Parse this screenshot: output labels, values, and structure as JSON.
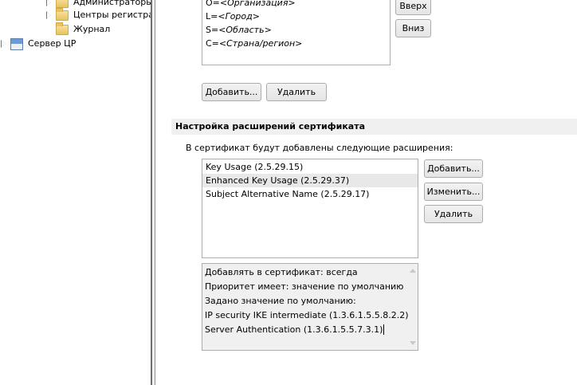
{
  "tree": {
    "items": [
      {
        "label": "Администраторы"
      },
      {
        "label": "Центры регистра"
      },
      {
        "label": "Журнал"
      },
      {
        "label": "Сервер ЦР"
      }
    ]
  },
  "subject_list": {
    "rows": [
      {
        "key": "O=",
        "value": "<Организация>"
      },
      {
        "key": "L=",
        "value": "<Город>"
      },
      {
        "key": "S=",
        "value": "<Область>"
      },
      {
        "key": "C=",
        "value": "<Страна/регион>"
      }
    ],
    "up_label": "Вверх",
    "down_label": "Вниз",
    "add_label": "Добавить...",
    "remove_label": "Удалить"
  },
  "extensions": {
    "section_title": "Настройка расширений сертификата",
    "intro": "В сертификат будут добавлены следующие расширения:",
    "items": [
      {
        "label": "Key Usage (2.5.29.15)"
      },
      {
        "label": "Enhanced Key Usage (2.5.29.37)"
      },
      {
        "label": "Subject Alternative Name (2.5.29.17)"
      }
    ],
    "add_label": "Добавить...",
    "edit_label": "Изменить...",
    "remove_label": "Удалить",
    "details": [
      "Добавлять в сертификат: всегда",
      "Приоритет имеет: значение по умолчанию",
      "Задано значение по умолчанию:",
      "IP security IKE intermediate (1.3.6.1.5.5.8.2.2)",
      "Server Authentication (1.3.6.1.5.5.7.3.1)"
    ]
  }
}
